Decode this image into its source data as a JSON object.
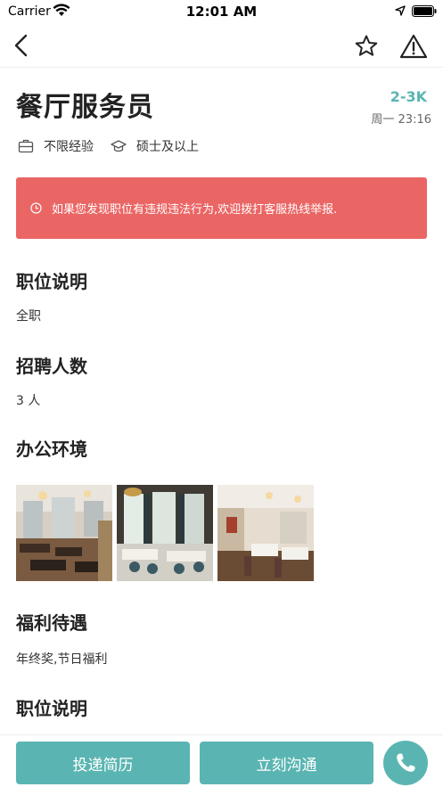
{
  "status_bar": {
    "carrier": "Carrier",
    "time": "12:01 AM"
  },
  "nav": {
    "icons": [
      "back-icon",
      "star-icon",
      "warning-icon"
    ]
  },
  "job": {
    "title": "餐厅服务员",
    "salary": "2-3K",
    "posted": "周一 23:16",
    "experience": "不限经验",
    "education": "硕士及以上"
  },
  "alert": {
    "text": "如果您发现职位有违规违法行为,欢迎拨打客服热线举报.",
    "color": "#ea6665"
  },
  "sections": {
    "description": {
      "title": "职位说明",
      "body": "全职"
    },
    "headcount": {
      "title": "招聘人数",
      "body": "3 人"
    },
    "environment": {
      "title": "办公环境"
    },
    "benefits": {
      "title": "福利待遇",
      "body": "年终奖,节日福利"
    },
    "description2": {
      "title": "职位说明"
    }
  },
  "actions": {
    "apply": "投递简历",
    "chat": "立刻沟通"
  },
  "colors": {
    "accent": "#5ab5b2",
    "alert": "#ea6665"
  }
}
